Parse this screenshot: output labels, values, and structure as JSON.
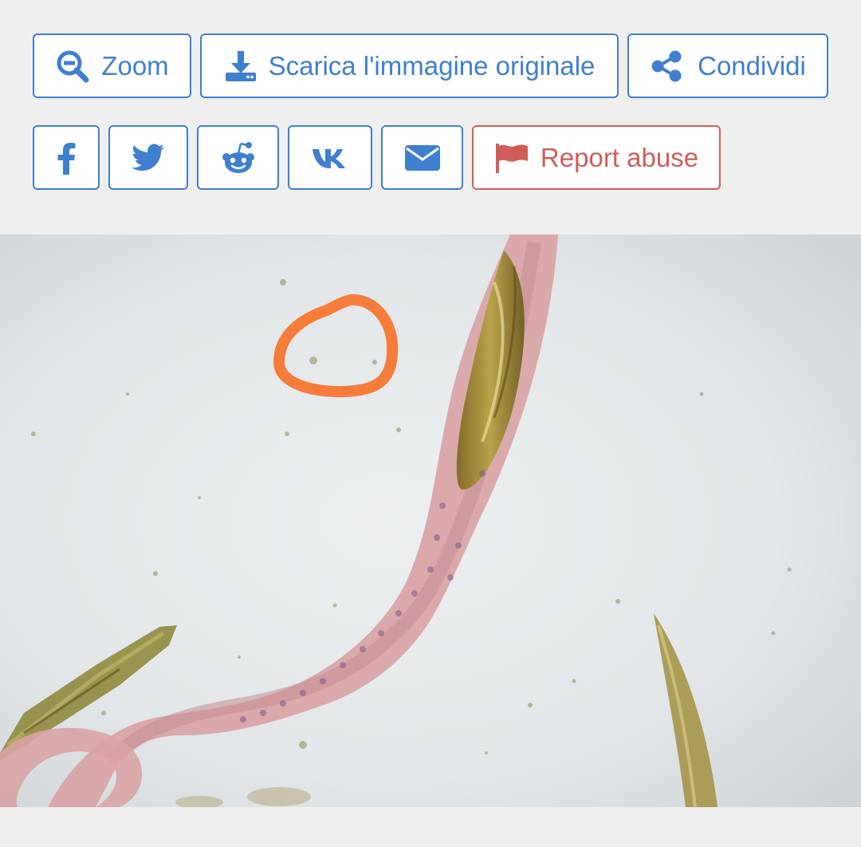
{
  "toolbar": {
    "zoom_label": "Zoom",
    "download_label": "Scarica l'immagine originale",
    "share_label": "Condividi"
  },
  "social": {
    "report_label": "Report abuse"
  },
  "icons": {
    "zoom": "zoom-out-icon",
    "download": "download-icon",
    "share": "share-icon",
    "facebook": "facebook-icon",
    "twitter": "twitter-icon",
    "reddit": "reddit-icon",
    "vk": "vk-icon",
    "email": "envelope-icon",
    "report": "flag-icon"
  },
  "colors": {
    "primary": "#3f7fcf",
    "danger": "#d05e58",
    "page_background": "#efefef",
    "annotation": "#f57c3a"
  }
}
